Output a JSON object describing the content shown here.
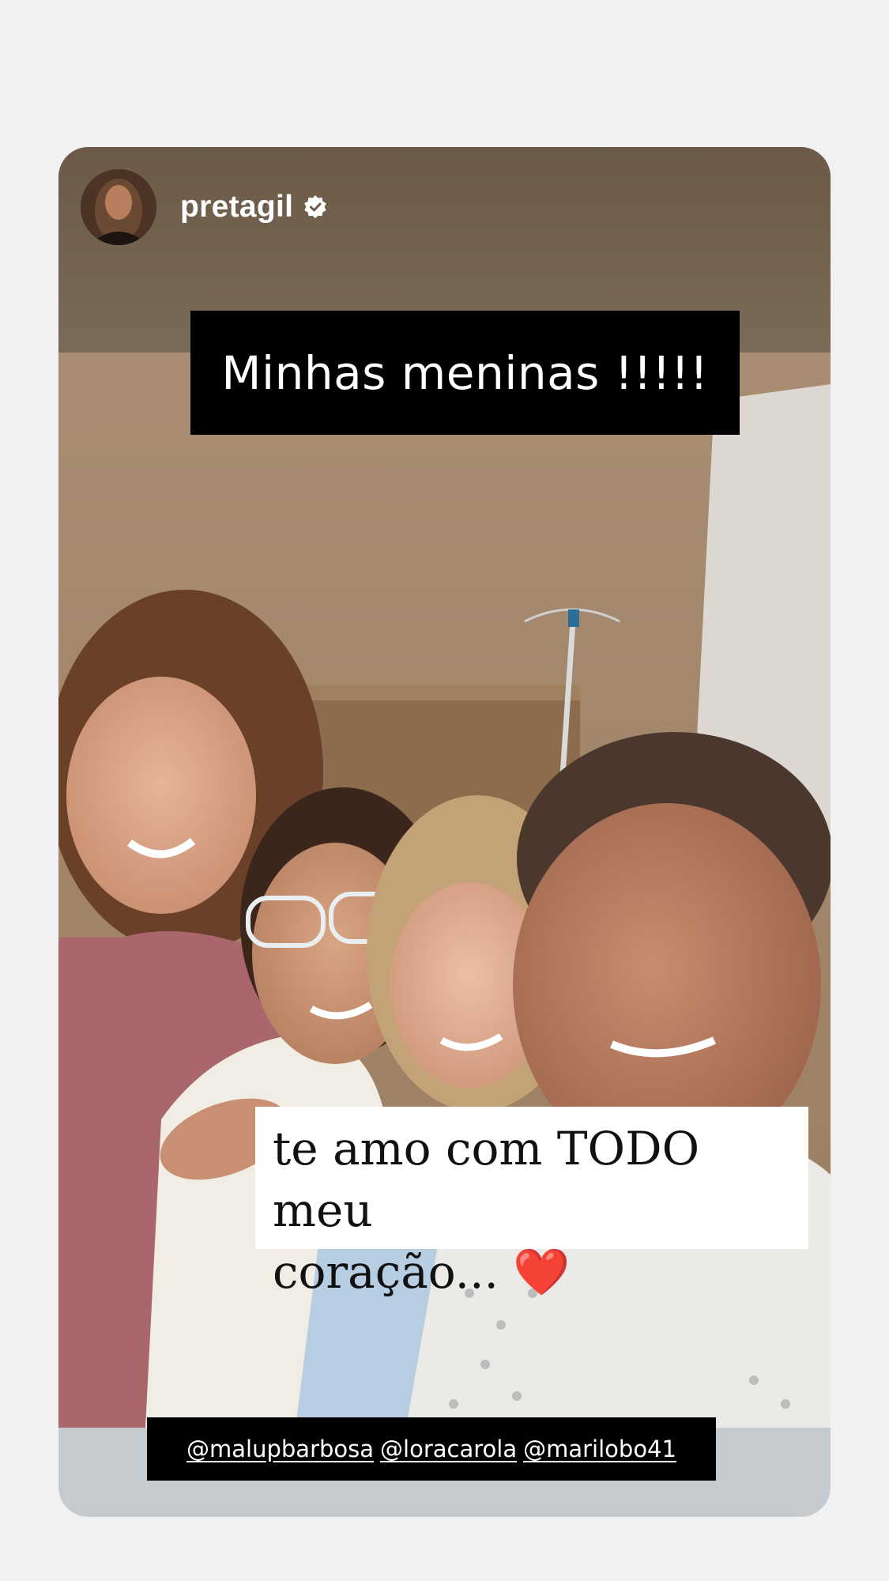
{
  "story": {
    "username": "pretagil",
    "verified": true,
    "title_sticker": "Minhas meninas !!!!!",
    "caption_line1": "te amo com TODO meu",
    "caption_line2": "coração...",
    "caption_emoji": "❤️",
    "mentions": [
      "@malupbarbosa",
      "@loracarola",
      "@marilobo41"
    ]
  },
  "icons": {
    "avatar": "profile-avatar",
    "verified": "verified-badge-icon"
  },
  "colors": {
    "page_background": "#f1f1f1",
    "sticker_background": "#000000",
    "caption_background": "#ffffff",
    "heart": "#e0121d"
  }
}
